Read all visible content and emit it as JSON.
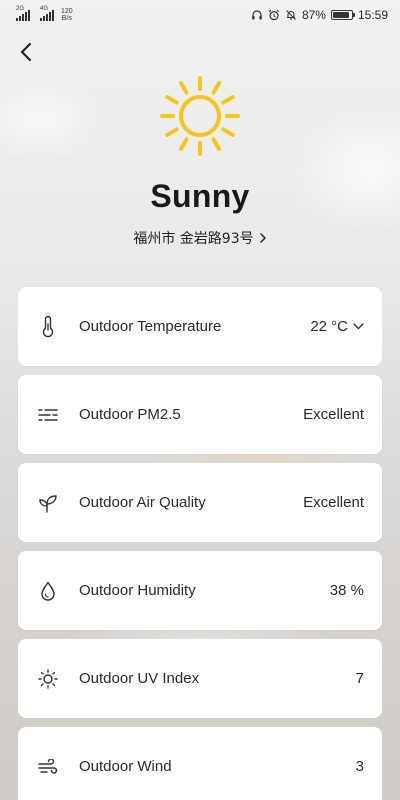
{
  "status_bar": {
    "sim1": "2G",
    "sim2": "4G",
    "net_speed_value": "120",
    "net_speed_unit": "B/s",
    "battery": "87%",
    "battery_level": 0.87,
    "time": "15:59",
    "icons": [
      "headphones-icon",
      "alarm-icon",
      "mute-icon",
      "battery-icon"
    ]
  },
  "header": {
    "condition": "Sunny",
    "location": "福州市 金岩路93号",
    "weather_icon": "sun-icon",
    "accent_color": "#f5c518"
  },
  "cards": [
    {
      "icon": "thermometer-icon",
      "label": "Outdoor Temperature",
      "value": "22 °C",
      "has_dropdown": true
    },
    {
      "icon": "pm25-icon",
      "label": "Outdoor PM2.5",
      "value": "Excellent"
    },
    {
      "icon": "leaf-icon",
      "label": "Outdoor Air Quality",
      "value": "Excellent"
    },
    {
      "icon": "droplet-icon",
      "label": "Outdoor Humidity",
      "value": "38 %"
    },
    {
      "icon": "uv-sun-icon",
      "label": "Outdoor UV Index",
      "value": "7"
    },
    {
      "icon": "wind-icon",
      "label": "Outdoor Wind",
      "value": "3"
    }
  ]
}
